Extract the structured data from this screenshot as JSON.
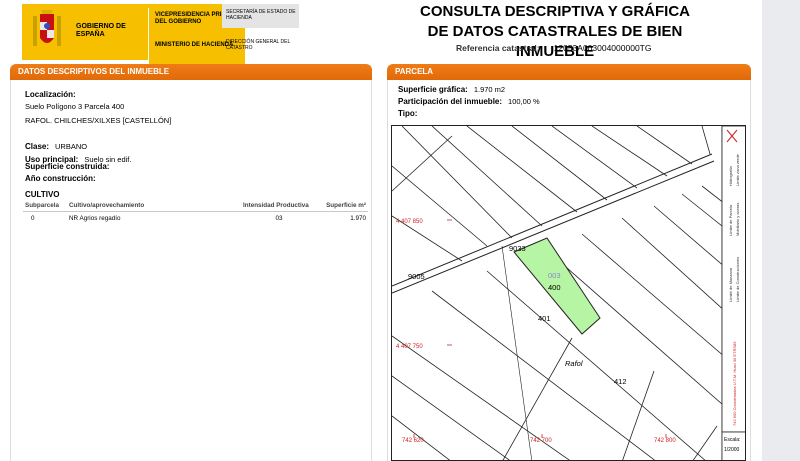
{
  "header": {
    "gobierno": "GOBIERNO DE ESPAÑA",
    "vicepresidencia": "VICEPRESIDENCIA PRIMERA DEL GOBIERNO",
    "ministerio": "MINISTERIO DE HACIENDA",
    "secretaria": "SECRETARÍA DE ESTADO DE HACIENDA",
    "direccion": "DIRECCIÓN GENERAL DEL CATASTRO",
    "title_line1": "CONSULTA DESCRIPTIVA Y GRÁFICA",
    "title_line2": "DE DATOS CATASTRALES DE BIEN INMUEBLE",
    "ref_label": "Referencia catastral:",
    "ref_value": "12053A003004000000TG"
  },
  "datos": {
    "section_title": "DATOS DESCRIPTIVOS DEL INMUEBLE",
    "localizacion_label": "Localización:",
    "localizacion_line1": "Suelo Polígono 3 Parcela 400",
    "localizacion_line2": "RAFOL. CHILCHES/XILXES [CASTELLÓN]",
    "clase_label": "Clase:",
    "clase_value": "URBANO",
    "uso_label": "Uso principal:",
    "uso_value": "Suelo sin edif.",
    "superficie_label": "Superficie construida:",
    "ano_label": "Año construcción:",
    "cultivo_title": "CULTIVO",
    "cultivo_headers": [
      "Subparcela",
      "Cultivo/aprovechamiento",
      "Intensidad Productiva",
      "Superficie m²"
    ],
    "cultivo_rows": [
      [
        "0",
        "NR Agrios regadío",
        "03",
        "1.970"
      ]
    ]
  },
  "parcela": {
    "section_title": "PARCELA",
    "sup_grafica_label": "Superficie gráfica:",
    "sup_grafica_value": "1.970 m2",
    "participacion_label": "Participación del inmueble:",
    "participacion_value": "100,00 %",
    "tipo_label": "Tipo:",
    "tipo_value": ""
  },
  "map": {
    "parcel_labels": [
      "9033",
      "9005",
      "003",
      "400",
      "401",
      "412",
      "Rafol"
    ],
    "coord_left_top": "4 407 850",
    "coord_left_bottom": "4 407 750",
    "coord_bottom": [
      "742 620",
      "742 700",
      "742 800"
    ],
    "legend_items": [
      "Límite de Manzana",
      "Límite de Parcela",
      "Límite de Construcciones",
      "Mobiliario y aceras",
      "Límite zona verde",
      "Hidrografía"
    ],
    "coord_system": "742 600 Coordenadas U.T.M. Huso 30 ETRS89",
    "scale_label": "Escala:",
    "scale_value": "1/2000",
    "highlight_color": "#b6f5a4",
    "line_color": "#222222",
    "coord_color": "#d02020"
  }
}
